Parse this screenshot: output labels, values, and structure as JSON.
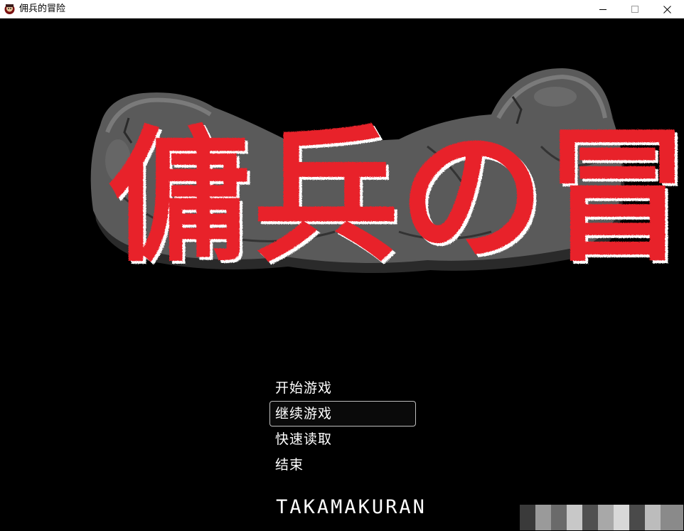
{
  "window": {
    "title": "佣兵的冒险",
    "icon": "mercenary-app-icon",
    "controls": [
      "minimize-icon",
      "maximize-icon",
      "close-icon"
    ]
  },
  "logo": {
    "text": "傭兵の冒険",
    "text_color": "#e8202a",
    "rock_color": "#555555"
  },
  "menu": {
    "items": [
      {
        "label": "开始游戏",
        "selected": false
      },
      {
        "label": "继续游戏",
        "selected": true
      },
      {
        "label": "快速读取",
        "selected": false
      },
      {
        "label": "结束",
        "selected": false
      }
    ]
  },
  "footer": {
    "credit": "TAKAMAKURAN"
  }
}
